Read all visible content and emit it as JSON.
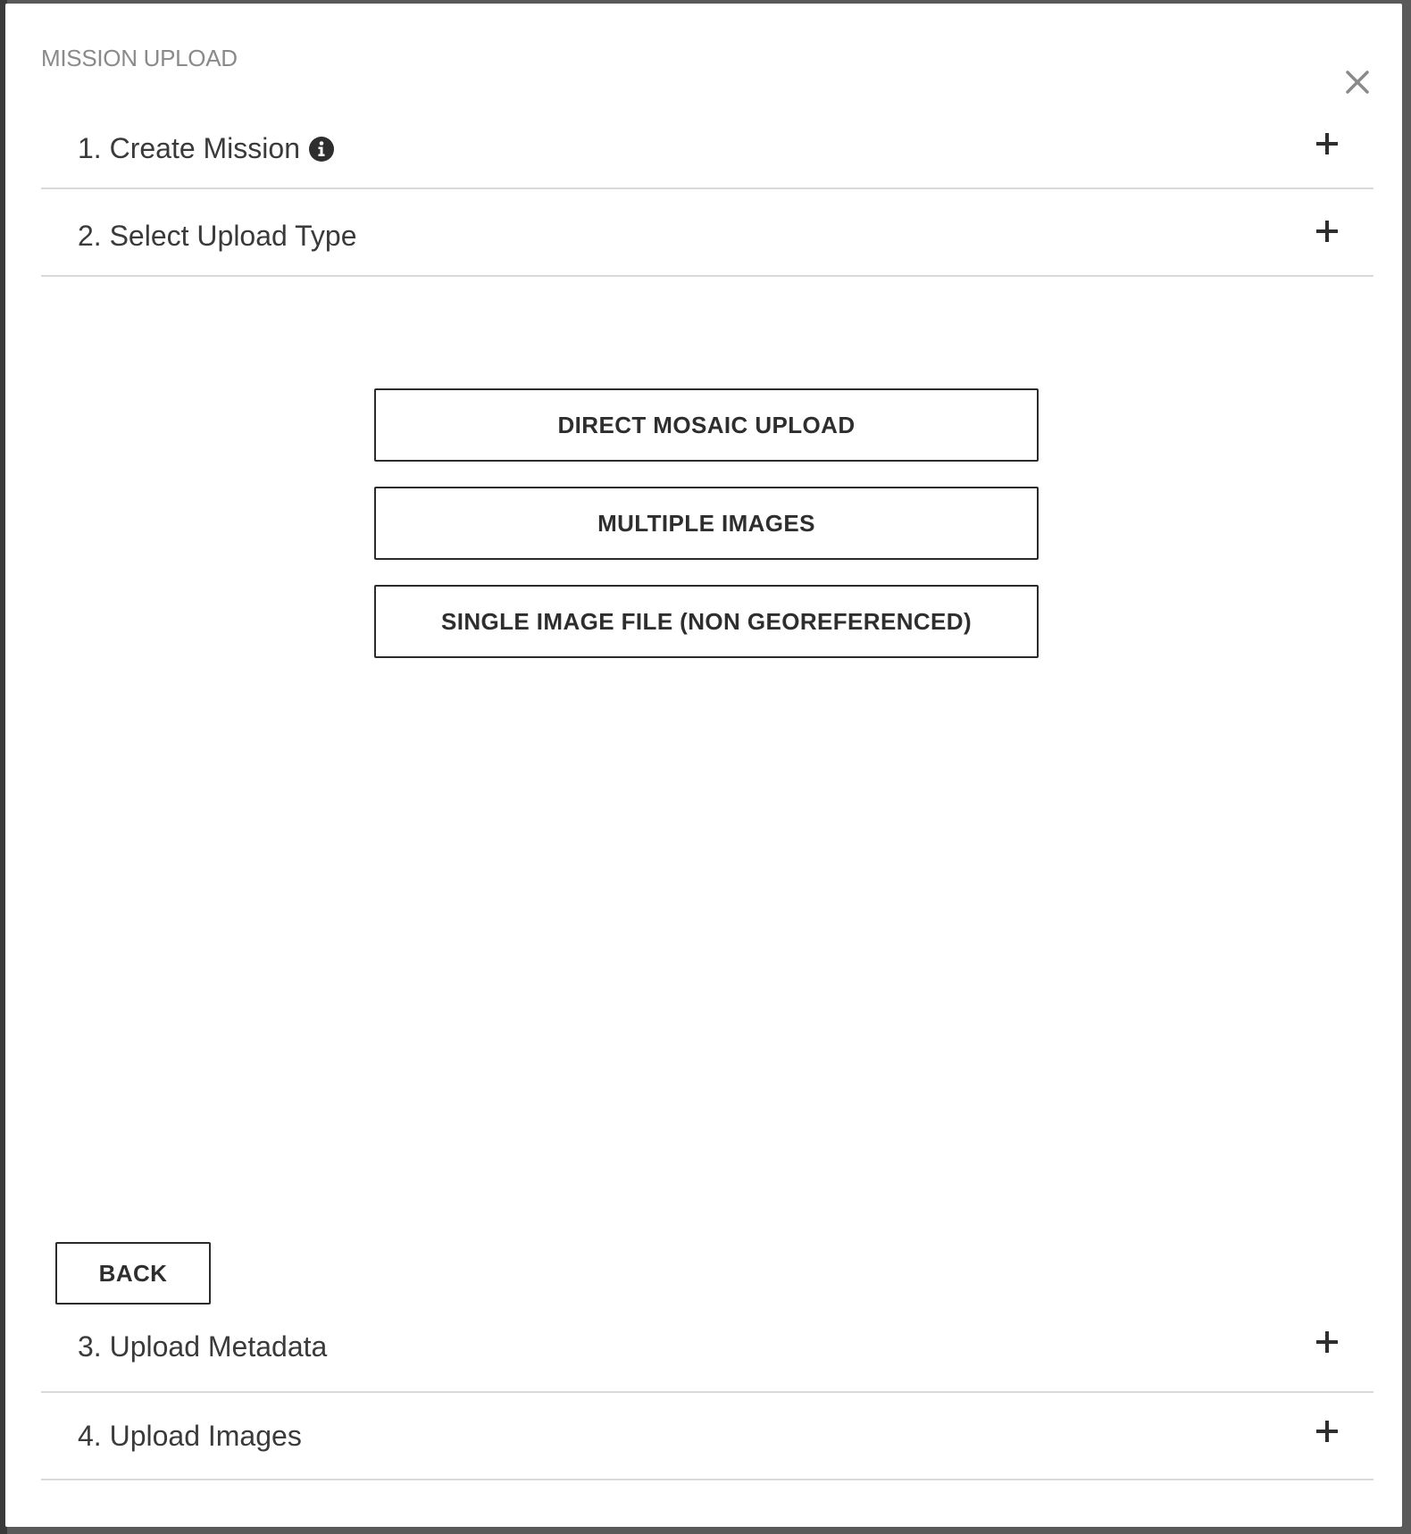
{
  "modal": {
    "title": "MISSION UPLOAD",
    "close_icon": "close-icon"
  },
  "steps": [
    {
      "label": "1. Create Mission",
      "has_info_icon": true,
      "toggle_icon": "plus-icon"
    },
    {
      "label": "2. Select Upload Type",
      "toggle_icon": "plus-icon"
    },
    {
      "label": "3. Upload Metadata",
      "toggle_icon": "plus-icon"
    },
    {
      "label": "4. Upload Images",
      "toggle_icon": "plus-icon"
    }
  ],
  "upload_type": {
    "options": [
      {
        "label": "DIRECT MOSAIC UPLOAD"
      },
      {
        "label": "MULTIPLE IMAGES"
      },
      {
        "label": "SINGLE IMAGE FILE (NON GEOREFERENCED)"
      }
    ],
    "back_label": "BACK"
  },
  "colors": {
    "text": "#3a3a3a",
    "title": "#8a8a8a",
    "divider": "#d9d9d9",
    "border": "#2b2b2b"
  }
}
